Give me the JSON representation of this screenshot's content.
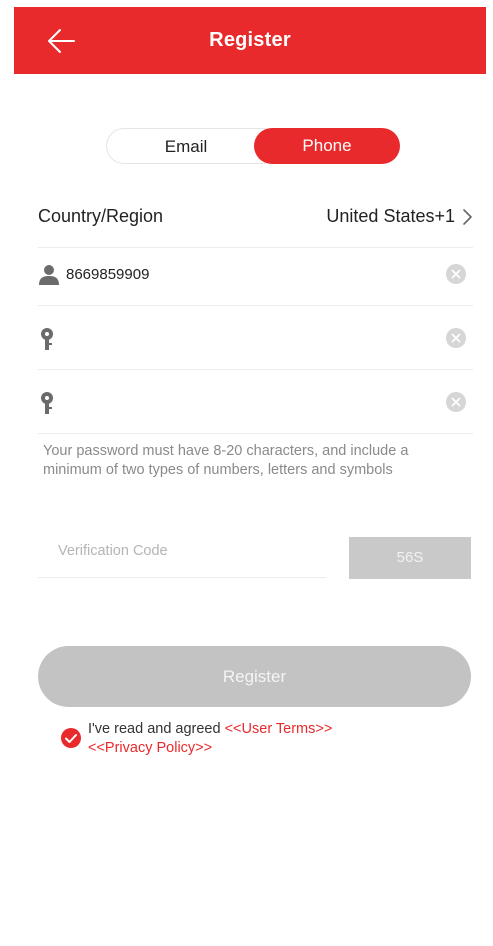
{
  "header": {
    "title": "Register",
    "back_icon": "arrow-left-icon",
    "bg_color": "#e92a2c"
  },
  "tabs": [
    {
      "label": "Email",
      "active": false
    },
    {
      "label": "Phone",
      "active": true
    }
  ],
  "country": {
    "label": "Country/Region",
    "value": "United States+1",
    "icon": "chevron-right-icon"
  },
  "phone": {
    "value": "8669859909",
    "icon": "user-icon"
  },
  "password": {
    "value": "",
    "icon": "key-icon"
  },
  "confirm_password": {
    "value": "",
    "icon": "key-icon"
  },
  "password_hint": "Your password must have 8-20 characters, and include a minimum of two types of numbers, letters and symbols",
  "verification": {
    "placeholder": "Verification Code",
    "countdown_label": "56S"
  },
  "register_button": "Register",
  "agreement": {
    "checked": true,
    "prefix": "I've read and agreed ",
    "user_terms": "<<User Terms>>",
    "privacy_policy": "<<Privacy Policy>>"
  },
  "colors": {
    "accent": "#e92a2c",
    "disabled_button": "#c3c3c3",
    "hint_text": "#8a8a8a"
  }
}
